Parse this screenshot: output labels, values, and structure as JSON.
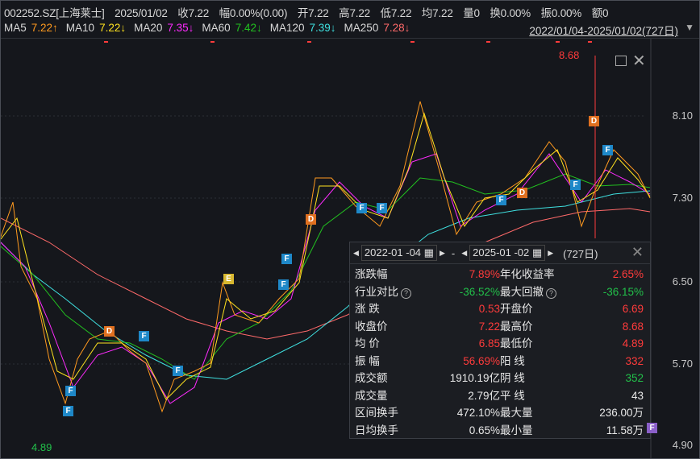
{
  "header": {
    "code": "002252.SZ[上海莱士]",
    "date": "2025/01/02",
    "close": "收7.22",
    "change": "幅0.00%(0.00)",
    "open": "开7.22",
    "high": "高7.22",
    "low": "低7.22",
    "avg": "均7.22",
    "volume": "量0",
    "turnover": "换0.00%",
    "amplitude": "振0.00%",
    "amount": "额0"
  },
  "ma": [
    {
      "label": "MA5",
      "value": "7.22↑",
      "color": "#ff9a1f"
    },
    {
      "label": "MA10",
      "value": "7.22↓",
      "color": "#ffe21f"
    },
    {
      "label": "MA20",
      "value": "7.35↓",
      "color": "#ff2bff"
    },
    {
      "label": "MA60",
      "value": "7.42↓",
      "color": "#22c020"
    },
    {
      "label": "MA120",
      "value": "7.39↓",
      "color": "#3fe0e0"
    },
    {
      "label": "MA250",
      "value": "7.28↓",
      "color": "#ff6a6a"
    }
  ],
  "range": "2022/01/04-2025/01/02(727日)",
  "yaxis": [
    "8.10",
    "7.30",
    "6.50",
    "5.70",
    "4.90"
  ],
  "max_label": "8.68",
  "min_label": "4.89",
  "markers": [
    "F",
    "F",
    "D",
    "F",
    "F",
    "E",
    "F",
    "F",
    "D",
    "F",
    "F",
    "D",
    "D",
    "F",
    "F",
    "F"
  ],
  "panel": {
    "start": "2022-01 -04",
    "dash": "-",
    "end": "2025-01 -02",
    "days": "(727日)",
    "rows": [
      [
        "涨跌幅",
        "7.89%",
        "red",
        "年化收益率",
        "2.65%",
        "red"
      ],
      [
        "行业对比",
        "-36.52%",
        "green",
        "最大回撤",
        "-36.15%",
        "green"
      ],
      [
        "涨  跌",
        "0.53",
        "red",
        "开盘价",
        "6.69",
        "red"
      ],
      [
        "收盘价",
        "7.22",
        "red",
        "最高价",
        "8.68",
        "red"
      ],
      [
        "均  价",
        "6.85",
        "red",
        "最低价",
        "4.89",
        "red"
      ],
      [
        "振  幅",
        "56.69%",
        "red",
        "阳  线",
        "332",
        "red"
      ],
      [
        "成交额",
        "1910.19亿",
        "white",
        "阴  线",
        "352",
        "green"
      ],
      [
        "成交量",
        "2.79亿",
        "white",
        "平  线",
        "43",
        "white"
      ],
      [
        "区间换手",
        "472.10%",
        "white",
        "最大量",
        "236.00万",
        "white"
      ],
      [
        "日均换手",
        "0.65%",
        "white",
        "最小量",
        "11.58万",
        "white"
      ]
    ],
    "tail_marker": "F"
  }
}
